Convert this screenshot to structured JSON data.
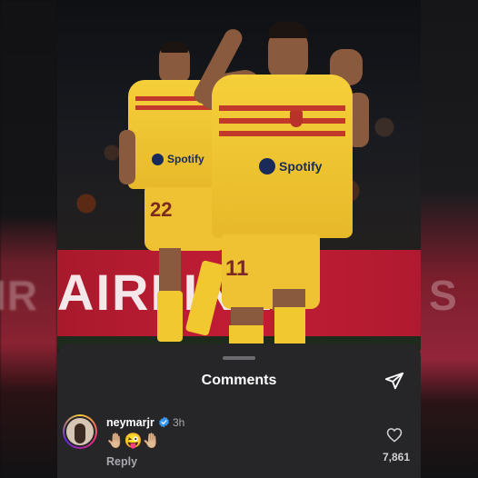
{
  "post": {
    "banner_text": "AIRLINES",
    "player_left_shirt_sponsor": "Spotify",
    "player_left_number": "22",
    "player_right_shirt_sponsor": "Spotify",
    "player_right_number": "11"
  },
  "side_ghost": {
    "left": "IR",
    "right": "S"
  },
  "comments_sheet": {
    "title": "Comments",
    "comment": {
      "username": "neymarjr",
      "verified": true,
      "time": "3h",
      "text": "🤚🏼😜🤚🏼",
      "reply_label": "Reply",
      "like_count": "7,861"
    }
  },
  "colors": {
    "sheet_bg": "#262629",
    "banner_red": "#c21d35",
    "kit_yellow": "#f5cf3a",
    "verified_blue": "#3797f0"
  },
  "icons": [
    "send-icon",
    "verified-badge-icon",
    "heart-outline-icon"
  ]
}
